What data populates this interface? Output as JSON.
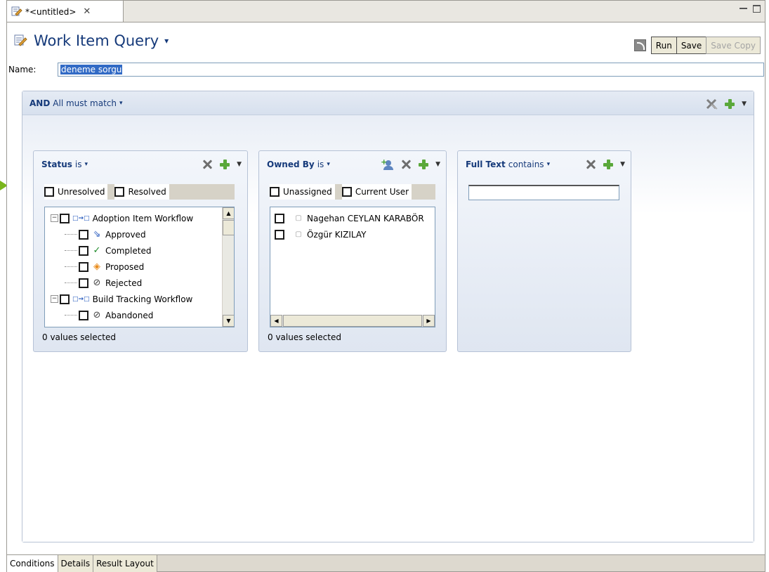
{
  "editor_tab": {
    "title": "*<untitled>",
    "close_glyph": "✕"
  },
  "header": {
    "title": "Work Item Query",
    "caret": "▾"
  },
  "toolbar": {
    "feed_icon": "rss-feed-icon",
    "run_label": "Run",
    "save_label": "Save",
    "save_copy_label": "Save Copy"
  },
  "name_field": {
    "label": "Name:",
    "value": "deneme sorgu"
  },
  "conditions": {
    "logic": "AND",
    "mode": "All must match",
    "caret": "▾"
  },
  "status_card": {
    "attribute": "Status",
    "operator": "is",
    "caret": "▾",
    "quick": [
      {
        "label": "Unresolved"
      },
      {
        "label": "Resolved"
      }
    ],
    "tree": [
      {
        "label": "Adoption Item Workflow",
        "level": 0,
        "expander": "⊟",
        "icon": "workflow-icon"
      },
      {
        "label": "Approved",
        "level": 1,
        "icon": "approved-icon",
        "glyph": "⇘"
      },
      {
        "label": "Completed",
        "level": 1,
        "icon": "checkmark-icon",
        "glyph": "✓"
      },
      {
        "label": "Proposed",
        "level": 1,
        "icon": "proposed-icon",
        "glyph": "◈"
      },
      {
        "label": "Rejected",
        "level": 1,
        "icon": "rejected-icon",
        "glyph": "⊘"
      },
      {
        "label": "Build Tracking Workflow",
        "level": 0,
        "expander": "⊟",
        "icon": "workflow-icon"
      },
      {
        "label": "Abandoned",
        "level": 1,
        "icon": "abandoned-icon",
        "glyph": "⊘"
      }
    ],
    "count_text": "0 values selected"
  },
  "owner_card": {
    "attribute": "Owned By",
    "operator": "is",
    "caret": "▾",
    "quick": [
      {
        "label": "Unassigned"
      },
      {
        "label": "Current User"
      }
    ],
    "users": [
      {
        "label": "Nagehan CEYLAN KARABÖR"
      },
      {
        "label": "Özgür KIZILAY"
      }
    ],
    "count_text": "0 values selected"
  },
  "fulltext_card": {
    "attribute": "Full Text",
    "operator": "contains",
    "caret": "▾",
    "value": ""
  },
  "bottom_tabs": [
    {
      "label": "Conditions",
      "active": true
    },
    {
      "label": "Details",
      "active": false
    },
    {
      "label": "Result Layout",
      "active": false
    }
  ],
  "colors": {
    "title_blue": "#163a7a",
    "plus_green": "#5aa83a",
    "selection_blue": "#316ac5",
    "marker_green": "#7ab51d"
  }
}
